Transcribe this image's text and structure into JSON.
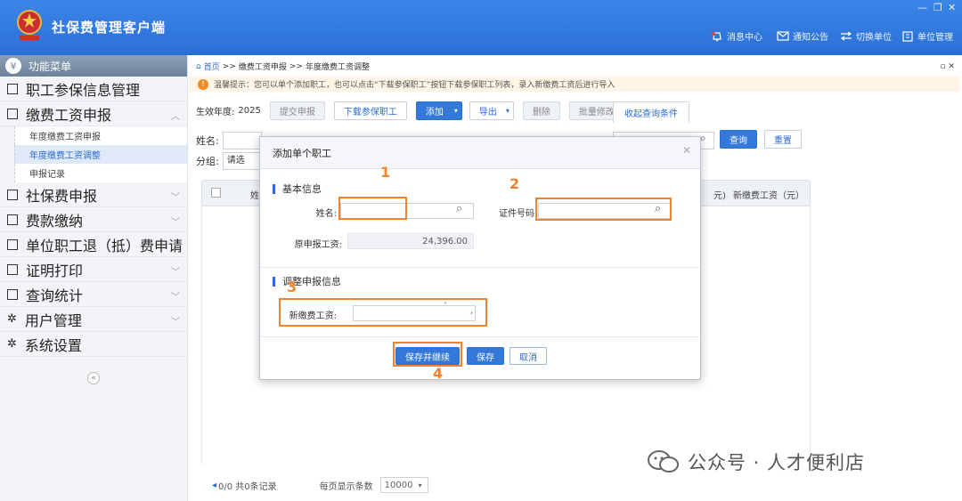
{
  "app": {
    "title": "社保费管理客户端"
  },
  "topnav": [
    {
      "label": "消息中心",
      "icon": "bell-icon"
    },
    {
      "label": "通知公告",
      "icon": "mail-icon"
    },
    {
      "label": "切换单位",
      "icon": "switch-icon"
    },
    {
      "label": "单位管理",
      "icon": "building-icon"
    }
  ],
  "sidebar": {
    "header": "功能菜单",
    "items": [
      {
        "label": "职工参保信息管理"
      },
      {
        "label": "缴费工资申报"
      },
      {
        "label": "社保费申报"
      },
      {
        "label": "费款缴纳"
      },
      {
        "label": "单位职工退（抵）费申请"
      },
      {
        "label": "证明打印"
      },
      {
        "label": "查询统计"
      },
      {
        "label": "用户管理"
      },
      {
        "label": "系统设置"
      }
    ],
    "subitems": [
      {
        "label": "年度缴费工资申报"
      },
      {
        "label": "年度缴费工资调整"
      },
      {
        "label": "申报记录"
      }
    ]
  },
  "breadcrumb": {
    "home": "首页",
    "sep": ">>",
    "level1": "缴费工资申报",
    "level2": "年度缴费工资调整"
  },
  "notice": "温馨提示：您可以单个添加职工，也可以点击“下载参保职工”按钮下载参保职工列表，录入新缴费工资后进行导入",
  "toolbar": {
    "year_label": "生效年度:",
    "year_value": "2025",
    "submit": "提交申报",
    "download": "下载参保职工",
    "add": "添加",
    "export": "导出",
    "delete": "删除",
    "batch_edit": "批量修改",
    "collapse_query": "收起查询条件"
  },
  "filters": {
    "name_label": "姓名:",
    "group_label": "分组:",
    "group_placeholder": "请选",
    "query": "查询",
    "reset": "重置"
  },
  "grid": {
    "last_header_fragment": "元)",
    "new_wage_header": "新缴费工资（元）",
    "first_col_fragment": "姓"
  },
  "pager": {
    "info": "0/0  共0条记录",
    "per_page_label": "每页显示条数",
    "per_page_value": "10000"
  },
  "modal": {
    "title": "添加单个职工",
    "section_basic": "基本信息",
    "name_label": "姓名:",
    "id_label": "证件号码",
    "orig_wage_label": "原申报工资:",
    "orig_wage_value": "24,396.00",
    "section_adjust": "调整申报信息",
    "new_wage_label": "新缴费工资:",
    "btn_save_continue": "保存并继续",
    "btn_save": "保存",
    "btn_cancel": "取消"
  },
  "annotations": [
    "1",
    "2",
    "3",
    "4"
  ],
  "watermark": "公众号 · 人才便利店",
  "colors": {
    "title_bar": "#2a6fd6",
    "primary": "#3478d9",
    "highlight": "#f0832b",
    "notice_bg": "#fff4e5"
  }
}
